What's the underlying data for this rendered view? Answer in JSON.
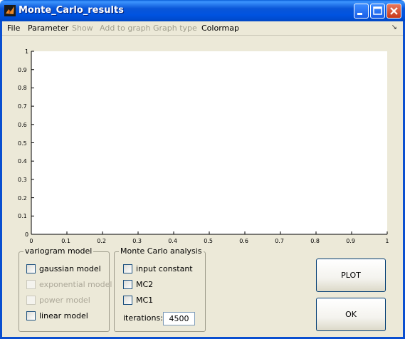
{
  "window": {
    "title": "Monte_Carlo_results",
    "buttons": {
      "minimize": "minimize-icon",
      "maximize": "maximize-icon",
      "close": "close-icon"
    }
  },
  "menubar": {
    "items": [
      {
        "label": "File",
        "enabled": true
      },
      {
        "label": "Parameter",
        "enabled": true
      },
      {
        "label": "Show",
        "enabled": false
      },
      {
        "label": "Add to graph",
        "enabled": false
      },
      {
        "label": "Graph type",
        "enabled": false
      },
      {
        "label": "Colormap",
        "enabled": true
      }
    ],
    "corner_icon": "dock-arrow-icon"
  },
  "chart_data": {
    "type": "line",
    "series": [],
    "xlim": [
      0,
      1
    ],
    "ylim": [
      0,
      1
    ],
    "xticks": [
      "0",
      "0.1",
      "0.2",
      "0.3",
      "0.4",
      "0.5",
      "0.6",
      "0.7",
      "0.8",
      "0.9",
      "1"
    ],
    "yticks": [
      "0",
      "0.1",
      "0.2",
      "0.3",
      "0.4",
      "0.5",
      "0.6",
      "0.7",
      "0.8",
      "0.9",
      "1"
    ],
    "grid": false
  },
  "variogram_panel": {
    "title": "variogram model",
    "options": [
      {
        "label": "gaussian model",
        "enabled": true,
        "checked": false
      },
      {
        "label": "exponential model",
        "enabled": false,
        "checked": false
      },
      {
        "label": "power model",
        "enabled": false,
        "checked": false
      },
      {
        "label": "linear model",
        "enabled": true,
        "checked": false
      }
    ]
  },
  "monte_carlo_panel": {
    "title": "Monte Carlo analysis",
    "options": [
      {
        "label": "input constant",
        "checked": false
      },
      {
        "label": "MC2",
        "checked": false
      },
      {
        "label": "MC1",
        "checked": false
      }
    ],
    "iterations_label": "iterations:",
    "iterations_value": "4500"
  },
  "actions": {
    "plot_label": "PLOT",
    "ok_label": "OK"
  },
  "colors": {
    "titlebar": "#0054e3",
    "window_bg": "#ece9d8",
    "disabled_text": "#a2a08f"
  }
}
